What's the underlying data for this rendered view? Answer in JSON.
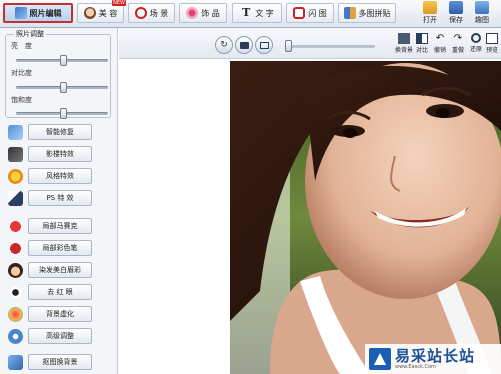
{
  "toolbar": {
    "tabs": [
      {
        "label": "照片编辑",
        "icon": "photo-edit-icon",
        "active": true
      },
      {
        "label": "美 容",
        "icon": "beauty-face-icon",
        "badge": "NEW"
      },
      {
        "label": "场 景",
        "icon": "scene-icon"
      },
      {
        "label": "饰 品",
        "icon": "accessory-icon"
      },
      {
        "label": "文 字",
        "icon": "text-t-icon"
      },
      {
        "label": "闪 图",
        "icon": "flash-image-icon"
      },
      {
        "label": "多图拼贴",
        "icon": "collage-icon"
      }
    ],
    "actions": [
      {
        "label": "打开",
        "icon": "open-folder-icon"
      },
      {
        "label": "保存",
        "icon": "save-disk-icon"
      },
      {
        "label": "趣图",
        "icon": "fun-image-icon"
      }
    ]
  },
  "left_panel": {
    "adjust_title": "照片调整",
    "sliders": [
      {
        "label": "亮　度",
        "value_fraction": 0.52
      },
      {
        "label": "对比度",
        "value_fraction": 0.52
      },
      {
        "label": "饱和度",
        "value_fraction": 0.52
      }
    ],
    "tools": [
      {
        "label": "智能修复",
        "icon": "smart-repair-icon"
      },
      {
        "label": "影楼特效",
        "icon": "studio-effects-icon"
      },
      {
        "label": "风格特效",
        "icon": "style-effects-icon"
      },
      {
        "label": "PS 特 效",
        "icon": "ps-effects-icon"
      },
      {
        "label": "局部马赛克",
        "icon": "mosaic-icon"
      },
      {
        "label": "局部彩色笔",
        "icon": "color-pen-icon"
      },
      {
        "label": "染发美白眉彩",
        "icon": "hair-dye-icon"
      },
      {
        "label": "去 红 眼",
        "icon": "red-eye-icon"
      },
      {
        "label": "背景虚化",
        "icon": "blur-background-icon"
      },
      {
        "label": "高级调整",
        "icon": "advanced-adjust-icon"
      },
      {
        "label": "抠图换背景",
        "icon": "cutout-background-icon"
      }
    ]
  },
  "viewer": {
    "zoom_fraction": 0.0,
    "tools": [
      {
        "label": "换背景",
        "icon": "swap-background-icon"
      },
      {
        "label": "对比",
        "icon": "compare-icon"
      },
      {
        "label": "撤销",
        "icon": "undo-icon"
      },
      {
        "label": "重做",
        "icon": "redo-icon"
      },
      {
        "label": "还原",
        "icon": "restore-icon"
      },
      {
        "label": "预览",
        "icon": "preview-icon"
      }
    ]
  },
  "watermark": {
    "title": "易采站长站",
    "subtitle": "www.Easck.Com"
  },
  "colors": {
    "active_tab_border": "#c43030",
    "toolbar_bg": "#e6ebf3",
    "watermark_blue": "#1a4f99"
  }
}
